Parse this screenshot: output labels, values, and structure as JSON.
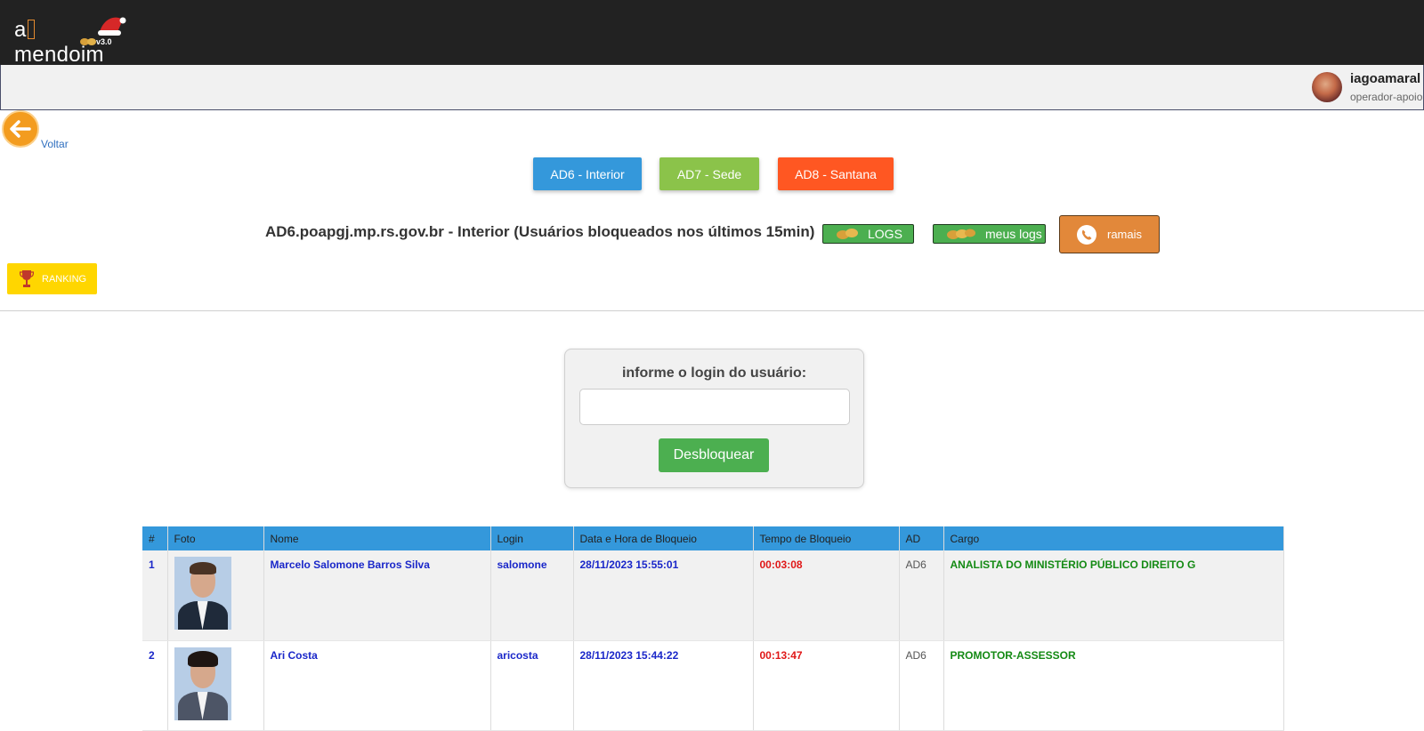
{
  "header": {
    "logo_text_prefix": "a",
    "logo_text_suffix": "mendoim",
    "version": "v3.0"
  },
  "user": {
    "name": "iagoamaral",
    "role": "operador-apoio"
  },
  "nav": {
    "back_label": "Voltar"
  },
  "domains": {
    "ad6": "AD6 - Interior",
    "ad7": "AD7 - Sede",
    "ad8": "AD8 - Santana"
  },
  "page": {
    "title": "AD6.poapgj.mp.rs.gov.br - Interior (Usuários bloqueados nos últimos 15min)"
  },
  "toolbar": {
    "logs_label": "LOGS",
    "meus_logs_label": "meus logs",
    "ramais_label": "ramais",
    "ranking_label": "RANKING"
  },
  "unlock": {
    "label": "informe o login do usuário:",
    "input_value": "",
    "button_label": "Desbloquear"
  },
  "table": {
    "columns": [
      "#",
      "Foto",
      "Nome",
      "Login",
      "Data e Hora de Bloqueio",
      "Tempo de Bloqueio",
      "AD",
      "Cargo"
    ],
    "rows": [
      {
        "idx": "1",
        "nome": "Marcelo Salomone Barros Silva",
        "login": "salomone",
        "data": "28/11/2023 15:55:01",
        "tempo": "00:03:08",
        "ad": "AD6",
        "cargo": "ANALISTA DO MINISTÉRIO PÚBLICO DIREITO G"
      },
      {
        "idx": "2",
        "nome": "Ari Costa",
        "login": "aricosta",
        "data": "28/11/2023 15:44:22",
        "tempo": "00:13:47",
        "ad": "AD6",
        "cargo": "PROMOTOR-ASSESSOR"
      }
    ]
  },
  "colors": {
    "topbar": "#222222",
    "ad6": "#3498db",
    "ad7": "#8bc34a",
    "ad8": "#ff5722",
    "logs": "#4caf50",
    "ramais": "#e2883a",
    "ranking": "#ffd600",
    "table_header": "#3498db",
    "link_blue": "#1a27c9",
    "time_red": "#e01818",
    "cargo_green": "#148a14"
  },
  "icons": {
    "back": "arrow-left-icon",
    "peanut": "peanut-icon",
    "phone": "phone-icon",
    "trophy": "trophy-icon",
    "santa_hat": "santa-hat-icon"
  }
}
